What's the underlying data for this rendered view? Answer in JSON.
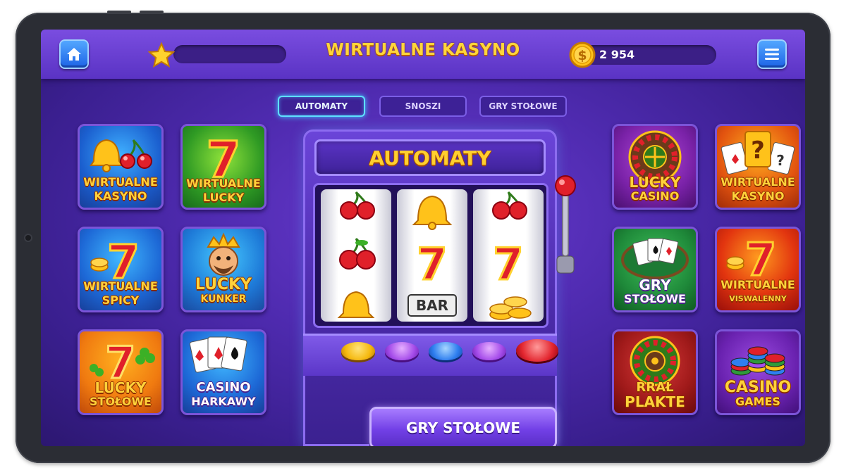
{
  "header": {
    "title": "WIRTUALNE KASYNO",
    "coins": "2 954",
    "home_icon": "home-icon",
    "menu_icon": "hamburger-menu-icon",
    "star_icon": "star-icon",
    "coin_icon": "dollar-coin-icon"
  },
  "tabs": [
    {
      "label": "AUTOMATY",
      "active": true
    },
    {
      "label": "SNOSZI",
      "active": false
    },
    {
      "label": "GRY STOŁOWE",
      "active": false
    }
  ],
  "left_tiles": [
    {
      "line1": "WIRTUALNE",
      "line2": "KASYNO",
      "icon": "bell-cherries-icon"
    },
    {
      "line1": "WIRTUALNE",
      "line2": "LUCKY",
      "icon": "lucky-seven-icon"
    },
    {
      "line1": "WIRTUALNE",
      "line2": "SPICY",
      "icon": "seven-coins-icon"
    },
    {
      "line1": "LUCKY",
      "line2": "KUNKER",
      "icon": "king-character-icon"
    },
    {
      "line1": "LUCKY",
      "line2": "STOŁOWE",
      "icon": "seven-clover-icon"
    },
    {
      "line1": "CASINO",
      "line2": "HARKAWY",
      "icon": "playing-cards-icon"
    }
  ],
  "right_tiles": [
    {
      "line1": "LUCKY",
      "line2": "CASINO",
      "icon": "roulette-wheel-icon"
    },
    {
      "line1": "WIRTUALNE",
      "line2": "KASYNO",
      "icon": "mystery-cards-icon"
    },
    {
      "line1": "GRY",
      "line2": "STOŁOWE",
      "icon": "card-table-icon"
    },
    {
      "line1": "WIRTUALNE",
      "line2": "VISWALENNY",
      "icon": "seven-coins-icon"
    },
    {
      "line1": "RRAŁ",
      "line2": "PLAKTE",
      "icon": "roulette-wheel-icon"
    },
    {
      "line1": "CASINO",
      "line2": "GAMES",
      "icon": "chip-stacks-icon"
    }
  ],
  "machine": {
    "title": "AUTOMATY",
    "reels": [
      [
        "cherries",
        "cherries",
        "bell"
      ],
      [
        "bell",
        "seven",
        "bar"
      ],
      [
        "cherries",
        "seven",
        "coins"
      ]
    ],
    "bar_label": "BAR",
    "button_colors": [
      "#f5b90f",
      "#a64dea",
      "#2f7ff0",
      "#a64dea",
      "#e3262f"
    ],
    "play_label": "GRY STOŁOWE"
  },
  "colors": {
    "accent_gold": "#ffd53a",
    "background_purple": "#4f2bb0",
    "tab_active_glow": "#5fe0ff"
  }
}
